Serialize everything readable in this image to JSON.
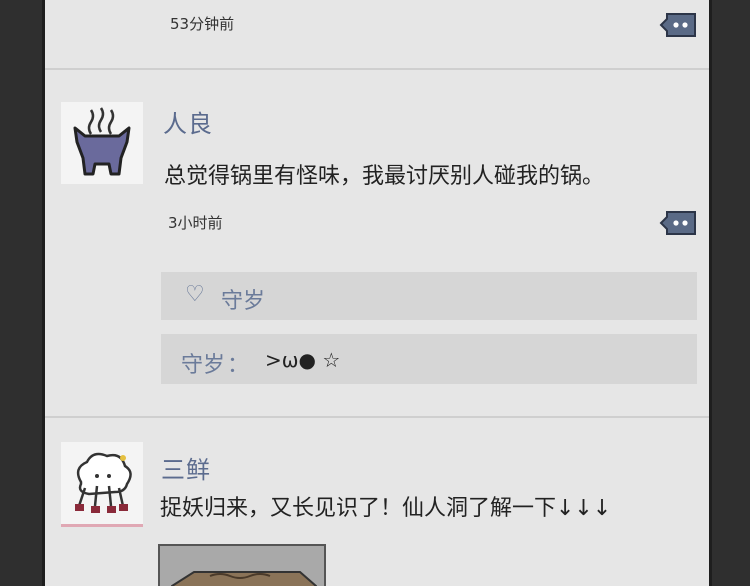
{
  "comments": [
    {
      "time": "53分钟前"
    },
    {
      "username": "人良",
      "content": "总觉得锅里有怪味，我最讨厌别人碰我的锅。",
      "time": "3小时前",
      "likes": {
        "icon": "heart-outline-icon",
        "glyph": "♡",
        "names": "守岁"
      },
      "replies": [
        {
          "author": "守岁",
          "colon": "：",
          "text": ">ω● ☆"
        }
      ]
    },
    {
      "username": "三鲜",
      "content": "捉妖归来，又长见识了！仙人洞了解一下↓↓↓"
    }
  ],
  "colors": {
    "panel_bg": "#e6e6e6",
    "username": "#5b6b8e",
    "reply_button": "#5a6a86"
  }
}
